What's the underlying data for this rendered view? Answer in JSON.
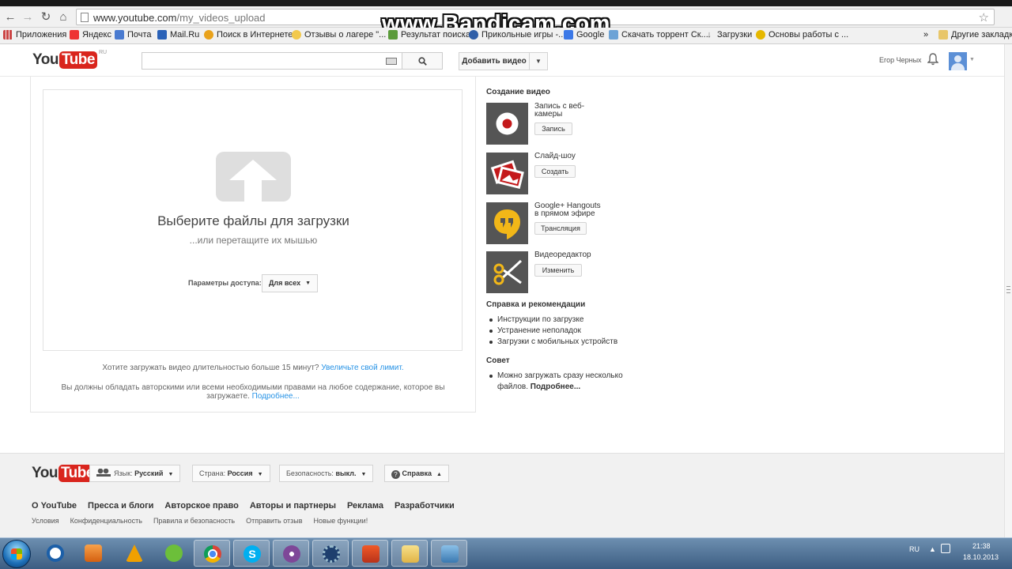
{
  "browser": {
    "url_host": "www.youtube.com",
    "url_path": "/my_videos_upload",
    "watermark": "www.Bandicam.com",
    "bookmarks": [
      {
        "label": "Приложения",
        "color": "#d44"
      },
      {
        "label": "Яндекс",
        "color": "#e33"
      },
      {
        "label": "Почта",
        "color": "#4a7bd0"
      },
      {
        "label": "Mail.Ru",
        "color": "#2a62b8"
      },
      {
        "label": "Поиск в Интернете",
        "color": "#e9a21b"
      },
      {
        "label": "Отзывы о лагере \"...",
        "color": "#f2c94c"
      },
      {
        "label": "Результат поиска",
        "color": "#5b9b3a"
      },
      {
        "label": "Прикольные игры -...",
        "color": "#2f5fa8"
      },
      {
        "label": "Google",
        "color": "#3b78e7"
      },
      {
        "label": "Скачать торрент Ск...",
        "color": "#6da3d6"
      },
      {
        "label": "Загрузки",
        "color": "#666"
      },
      {
        "label": "Основы работы с ...",
        "color": "#e6b800"
      }
    ],
    "bookmarks_more": "»",
    "bookmarks_other": "Другие закладки"
  },
  "header": {
    "logo_you": "You",
    "logo_tube": "Tube",
    "logo_region": "RU",
    "search_placeholder": "",
    "upload_button": "Добавить видео",
    "user_name": "Егор Черных"
  },
  "upload": {
    "title": "Выберите файлы для загрузки",
    "subtitle": "...или перетащите их мышью",
    "privacy_label": "Параметры доступа:",
    "privacy_value": "Для всех",
    "limit_text": "Хотите загружать видео длительностью больше 15 минут?",
    "limit_link": "Увеличьте свой лимит.",
    "rights_text_1": "Вы должны обладать авторскими или всеми необходимыми правами на любое содержание, которое вы",
    "rights_text_2": "загружаете.",
    "rights_link": "Подробнее..."
  },
  "sidebar": {
    "create_heading": "Создание видео",
    "tools": [
      {
        "label_1": "Запись с веб-",
        "label_2": "камеры",
        "button": "Запись",
        "icon": "record-icon"
      },
      {
        "label_1": "Слайд-шоу",
        "label_2": "",
        "button": "Создать",
        "icon": "slideshow-icon"
      },
      {
        "label_1": "Google+ Hangouts",
        "label_2": "в прямом эфире",
        "button": "Трансляция",
        "icon": "hangouts-icon"
      },
      {
        "label_1": "Видеоредактор",
        "label_2": "",
        "button": "Изменить",
        "icon": "scissors-icon"
      }
    ],
    "help_heading": "Справка и рекомендации",
    "help_items": [
      "Инструкции по загрузке",
      "Устранение неполадок",
      "Загрузки с мобильных устройств"
    ],
    "tip_heading": "Совет",
    "tip_text_1": "Можно загружать сразу несколько",
    "tip_text_2": "файлов.",
    "tip_link": "Подробнее..."
  },
  "footer": {
    "language_label": "Язык:",
    "language_value": "Русский",
    "country_label": "Страна:",
    "country_value": "Россия",
    "safety_label": "Безопасность:",
    "safety_value": "выкл.",
    "help_label": "Справка",
    "links": [
      "О YouTube",
      "Пресса и блоги",
      "Авторское право",
      "Авторы и партнеры",
      "Реклама",
      "Разработчики"
    ],
    "sublinks": [
      "Условия",
      "Конфиденциальность",
      "Правила и безопасность",
      "Отправить отзыв",
      "Новые функции!"
    ]
  },
  "taskbar": {
    "apps": [
      "ie-icon",
      "media-player-icon",
      "aimp-icon",
      "game-icon",
      "chrome-icon",
      "skype-icon",
      "tor-icon",
      "settings-icon",
      "subway-surfers-icon",
      "explorer-icon",
      "network-icon"
    ],
    "lang": "RU",
    "time": "21:38",
    "date": "18.10.2013"
  },
  "colors": {
    "accent": "#d9251d",
    "link": "#2793e6",
    "hangouts_yellow": "#f2b718",
    "record_red": "#c4191b"
  }
}
